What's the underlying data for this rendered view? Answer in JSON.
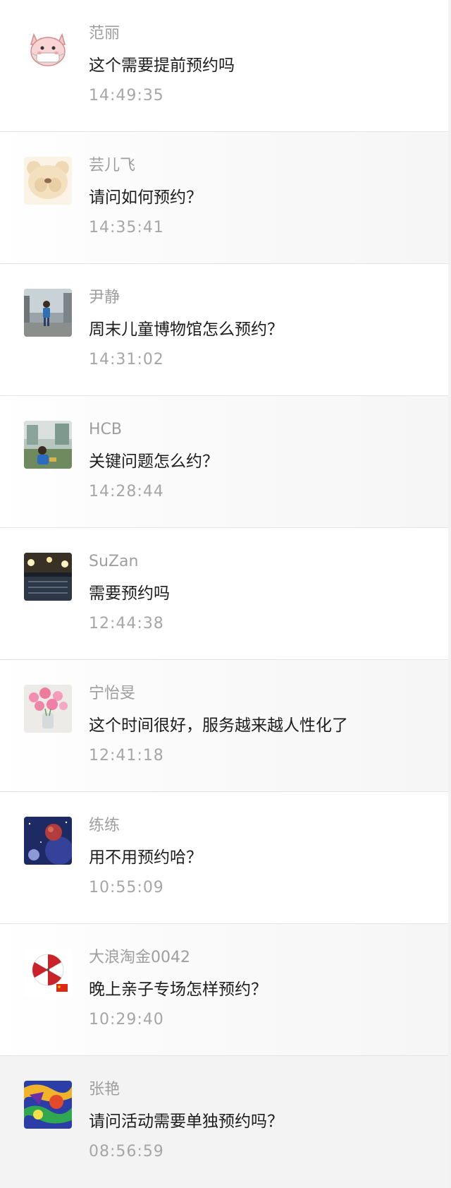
{
  "comments": [
    {
      "name": "范丽",
      "message": "这个需要提前预约吗",
      "time": "14:49:35",
      "avatar_icon": "pig-mask-avatar"
    },
    {
      "name": "芸儿飞",
      "message": "请问如何预约？",
      "time": "14:35:41",
      "avatar_icon": "teddy-bear-avatar"
    },
    {
      "name": "尹静",
      "message": "周末儿童博物馆怎么预约？",
      "time": "14:31:02",
      "avatar_icon": "child-photo-avatar"
    },
    {
      "name": "HCB",
      "message": "关键问题怎么约？",
      "time": "14:28:44",
      "avatar_icon": "child-outdoor-photo-avatar"
    },
    {
      "name": "SuZan",
      "message": "需要预约吗",
      "time": "12:44:38",
      "avatar_icon": "night-concert-avatar"
    },
    {
      "name": "宁怡旻",
      "message": "这个时间很好，服务越来越人性化了",
      "time": "12:41:18",
      "avatar_icon": "flowers-avatar"
    },
    {
      "name": "练练",
      "message": "用不用预约哈？",
      "time": "10:55:09",
      "avatar_icon": "planet-space-avatar"
    },
    {
      "name": "大浪淘金0042",
      "message": "晚上亲子专场怎样预约？",
      "time": "10:29:40",
      "avatar_icon": "umbrella-flag-avatar"
    },
    {
      "name": "张艳",
      "message": "请问活动需要单独预约吗？",
      "time": "08:56:59",
      "avatar_icon": "graffiti-avatar"
    }
  ],
  "colors": {
    "name_text": "#9e9e9e",
    "message_text": "#1d1d1d",
    "time_text": "#a6a6a6",
    "divider": "#e3e3e3",
    "last_row_background": "#f3f3f4"
  }
}
